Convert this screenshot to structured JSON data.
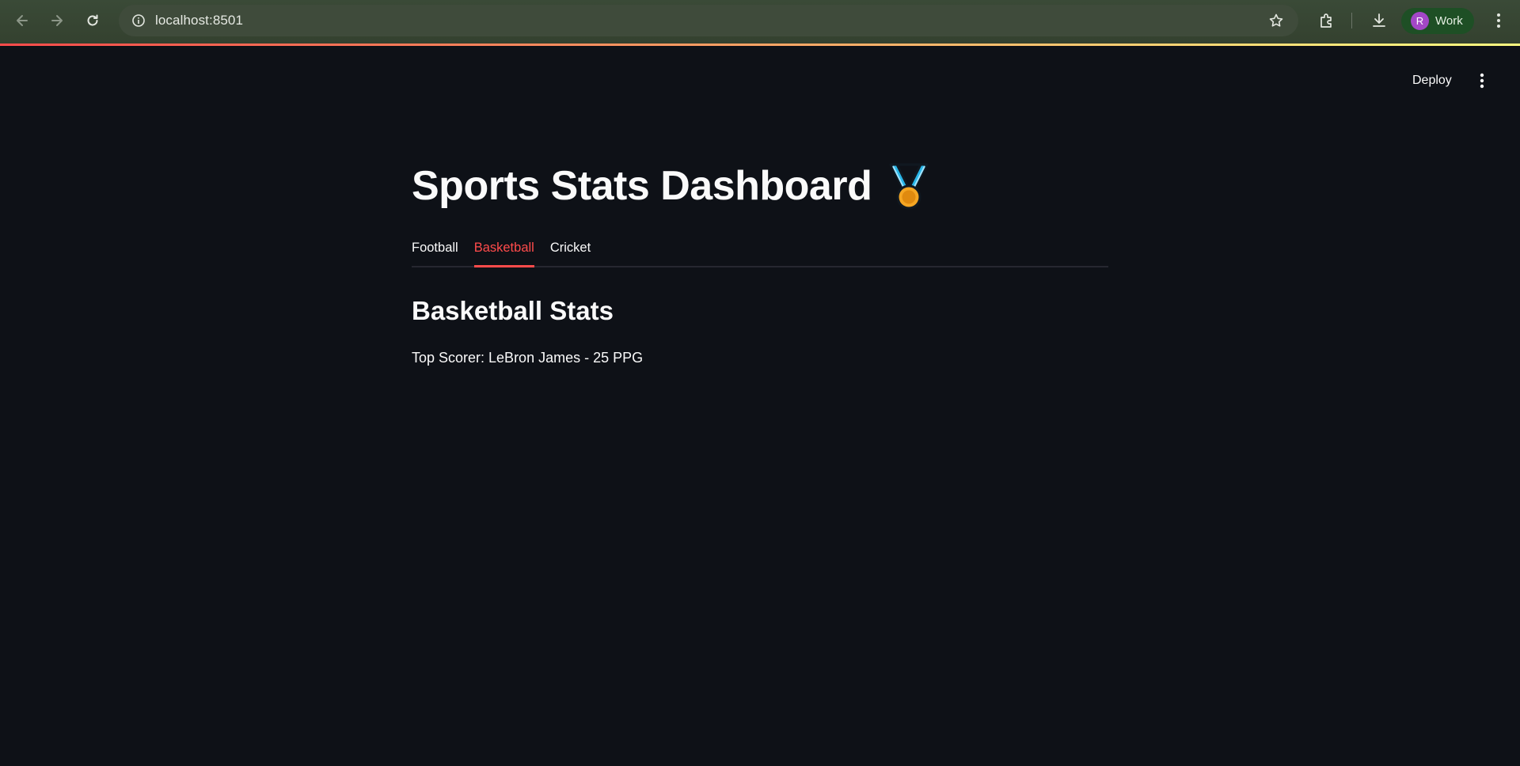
{
  "browser": {
    "url": "localhost:8501",
    "profile_initial": "R",
    "profile_label": "Work"
  },
  "header": {
    "deploy_label": "Deploy"
  },
  "main": {
    "title": "Sports Stats Dashboard",
    "title_icon": "medal-icon",
    "tabs": [
      {
        "label": "Football",
        "active": false
      },
      {
        "label": "Basketball",
        "active": true
      },
      {
        "label": "Cricket",
        "active": false
      }
    ],
    "section_heading": "Basketball Stats",
    "stat_line": "Top Scorer: LeBron James - 25 PPG"
  },
  "colors": {
    "accent": "#ff4b4b",
    "background": "#0e1117",
    "browser_frame": "#3a4a37",
    "profile_chip": "#1e4f25",
    "profile_avatar": "#a347c6"
  }
}
